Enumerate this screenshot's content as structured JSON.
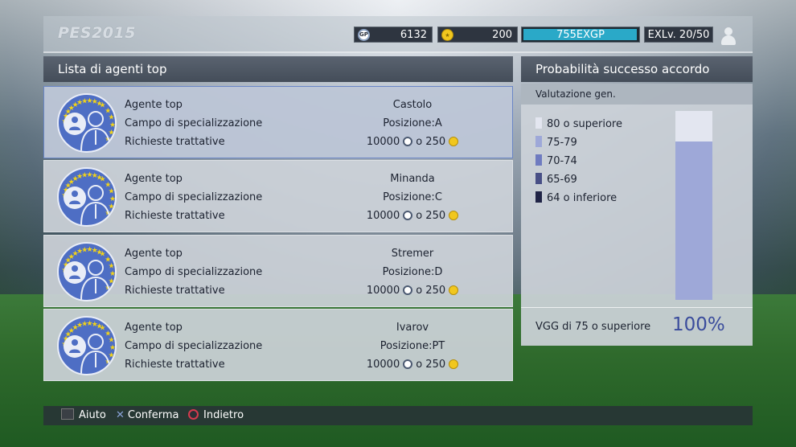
{
  "header": {
    "logo": "PES2015",
    "gp": {
      "icon": "gp-icon",
      "label": "GP",
      "value": "6132"
    },
    "coins": {
      "icon": "coin-icon",
      "value": "200"
    },
    "exgp": {
      "value": "755EXGP",
      "progress": 0.99
    },
    "level": "EXLv. 20/50",
    "avatar_icon": "user-avatar-icon"
  },
  "left_panel": {
    "title": "Lista di agenti top",
    "labels": {
      "agent": "Agente top",
      "field": "Campo di specializzazione",
      "cost": "Richieste trattative"
    },
    "agents": [
      {
        "name": "Castolo",
        "position": "Posizione:A",
        "gp_cost": "10000",
        "or": "o 250",
        "selected": true
      },
      {
        "name": "Minanda",
        "position": "Posizione:C",
        "gp_cost": "10000",
        "or": "o 250",
        "selected": false
      },
      {
        "name": "Stremer",
        "position": "Posizione:D",
        "gp_cost": "10000",
        "or": "o 250",
        "selected": false
      },
      {
        "name": "Ivarov",
        "position": "Posizione:PT",
        "gp_cost": "10000",
        "or": "o 250",
        "selected": false
      }
    ]
  },
  "right_panel": {
    "title": "Probabilità successo accordo",
    "subtitle": "Valutazione gen.",
    "legend": [
      {
        "label": "80 o superiore",
        "color": "#e3e6f0"
      },
      {
        "label": "75-79",
        "color": "#9ea8d8"
      },
      {
        "label": "70-74",
        "color": "#6f7bc0"
      },
      {
        "label": "65-69",
        "color": "#484f86"
      },
      {
        "label": "64 o inferiore",
        "color": "#202446"
      }
    ],
    "bar_fill_fraction": 0.84,
    "footer_label": "VGG di 75 o superiore",
    "footer_value": "100%"
  },
  "help": [
    {
      "icon": "square-button-icon",
      "label": "Aiuto"
    },
    {
      "icon": "cross-button-icon",
      "label": "Conferma"
    },
    {
      "icon": "circle-button-icon",
      "label": "Indietro"
    }
  ],
  "colors": {
    "header_bg": "#4c5562",
    "selected_border": "#6a86c6",
    "badge_blue": "#4e6ec4",
    "star_yellow": "#f1d21a"
  }
}
